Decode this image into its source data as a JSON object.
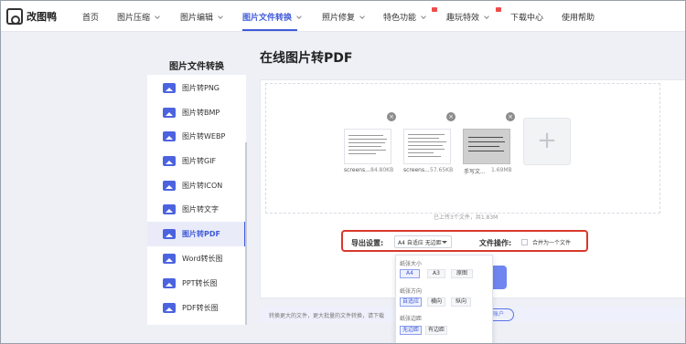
{
  "app": {
    "logo_text": "改图鸭"
  },
  "nav": {
    "items": [
      {
        "label": "首页"
      },
      {
        "label": "图片压缩"
      },
      {
        "label": "图片编辑"
      },
      {
        "label": "图片文件转换"
      },
      {
        "label": "照片修复"
      },
      {
        "label": "特色功能"
      },
      {
        "label": "趣玩特效"
      },
      {
        "label": "下载中心"
      },
      {
        "label": "使用帮助"
      }
    ],
    "active_index": 3
  },
  "sidebar": {
    "title": "图片文件转换",
    "items": [
      {
        "label": "图片转PNG"
      },
      {
        "label": "图片转BMP"
      },
      {
        "label": "图片转WEBP"
      },
      {
        "label": "图片转GIF"
      },
      {
        "label": "图片转ICON"
      },
      {
        "label": "图片转文字"
      },
      {
        "label": "图片转PDF"
      },
      {
        "label": "Word转长图"
      },
      {
        "label": "PPT转长图"
      },
      {
        "label": "PDF转长图"
      }
    ],
    "active_index": 6
  },
  "main": {
    "title": "在线图片转PDF",
    "files": [
      {
        "name": "screens...",
        "size": "84.80KB"
      },
      {
        "name": "screens...",
        "size": "57.65KB"
      },
      {
        "name": "手写文...",
        "size": "1.69MB"
      }
    ],
    "add_symbol": "+",
    "upload_summary": "已上传3个文件，共1.83M",
    "export_label": "导出设置:",
    "export_value": "A4 自适应 无边距",
    "file_op_label": "文件操作:",
    "merge_label": "合并为一个文件",
    "notice": "转换更大的文件，更大批量的文件转换，请下载",
    "account_btn": "账户"
  },
  "dropdown": {
    "paper_size_label": "纸张大小",
    "paper_sizes": [
      "A4",
      "A3",
      "原图"
    ],
    "paper_size_selected": "A4",
    "orientation_label": "纸张方向",
    "orientations": [
      "自适应",
      "横向",
      "纵向"
    ],
    "orientation_selected": "自适应",
    "margin_label": "纸张边距",
    "margins": [
      "无边距",
      "有边距"
    ],
    "margin_selected": "无边距"
  },
  "colors": {
    "accent": "#3f5ad8",
    "highlight_border": "#d8382b",
    "badge": "#f04b4b"
  }
}
